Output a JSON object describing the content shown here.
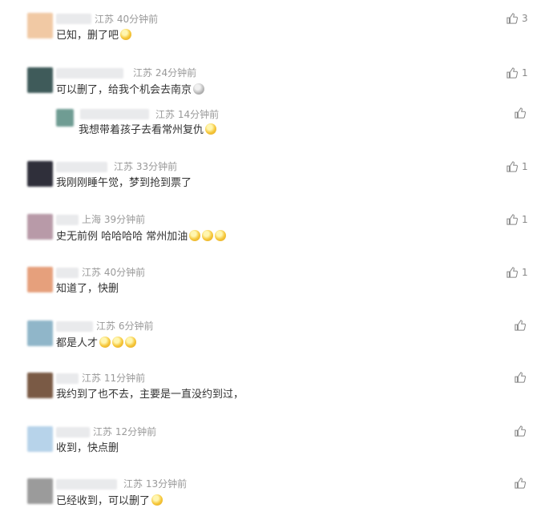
{
  "icons": {
    "like": "thumbs-up-icon"
  },
  "comments": [
    {
      "location": "江苏",
      "time": "40分钟前",
      "text": "已知，删了吧",
      "emojis": [
        "face-emoji"
      ],
      "likes": "3",
      "avatar_color": "#f1c9a4"
    },
    {
      "location": "江苏",
      "time": "24分钟前",
      "text": "可以删了，给我个机会去南京",
      "emojis": [
        "sleepy-emoji"
      ],
      "likes": "1",
      "avatar_color": "#3f5b5a"
    },
    {
      "location": "江苏",
      "time": "14分钟前",
      "text": "我想带着孩子去看常州复仇",
      "emojis": [
        "face-emoji"
      ],
      "likes": "",
      "avatar_color": "#6f9c93"
    },
    {
      "location": "江苏",
      "time": "33分钟前",
      "text": "我刚刚睡午觉，梦到抢到票了",
      "emojis": [],
      "likes": "1",
      "avatar_color": "#2f2f3a"
    },
    {
      "location": "上海",
      "time": "39分钟前",
      "text": "史无前例  哈哈哈哈 常州加油",
      "emojis": [
        "clap-emoji",
        "clap-emoji",
        "clap-emoji"
      ],
      "likes": "1",
      "avatar_color": "#b89aa8"
    },
    {
      "location": "江苏",
      "time": "40分钟前",
      "text": "知道了，快删",
      "emojis": [],
      "likes": "1",
      "avatar_color": "#e6a07c"
    },
    {
      "location": "江苏",
      "time": "6分钟前",
      "text": "都是人才",
      "emojis": [
        "face-emoji",
        "face-emoji",
        "face-emoji"
      ],
      "likes": "",
      "avatar_color": "#90b6c9"
    },
    {
      "location": "江苏",
      "time": "11分钟前",
      "text": "我约到了也不去，主要是一直没约到过，",
      "emojis": [],
      "likes": "",
      "avatar_color": "#7a5a45"
    },
    {
      "location": "江苏",
      "time": "12分钟前",
      "text": "收到，快点删",
      "emojis": [],
      "likes": "",
      "avatar_color": "#b7d3ea"
    },
    {
      "location": "江苏",
      "time": "13分钟前",
      "text": "已经收到，可以删了",
      "emojis": [
        "face-emoji"
      ],
      "likes": "",
      "avatar_color": "#9b9b9b"
    }
  ]
}
